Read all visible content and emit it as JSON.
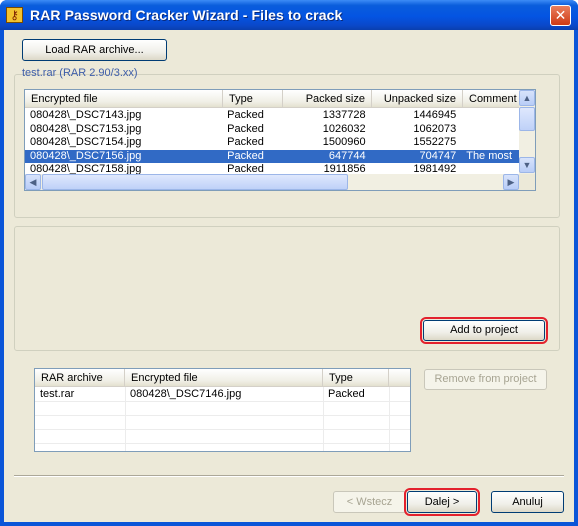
{
  "window": {
    "title": "RAR Password Cracker Wizard - Files to crack",
    "close_glyph": "✕",
    "icon": "app-icon"
  },
  "load_button": "Load RAR archive...",
  "archive_group_label": "test.rar (RAR 2.90/3.xx)",
  "archive_table": {
    "columns": [
      "Encrypted file",
      "Type",
      "Packed size",
      "Unpacked size",
      "Comment"
    ],
    "rows": [
      {
        "file": "080428\\_DSC7143.jpg",
        "type": "Packed",
        "packed": "1337728",
        "unpacked": "1446945",
        "comment": ""
      },
      {
        "file": "080428\\_DSC7153.jpg",
        "type": "Packed",
        "packed": "1026032",
        "unpacked": "1062073",
        "comment": ""
      },
      {
        "file": "080428\\_DSC7154.jpg",
        "type": "Packed",
        "packed": "1500960",
        "unpacked": "1552275",
        "comment": ""
      },
      {
        "file": "080428\\_DSC7156.jpg",
        "type": "Packed",
        "packed": "647744",
        "unpacked": "704747",
        "comment": "The most"
      },
      {
        "file": "080428\\_DSC7158.jpg",
        "type": "Packed",
        "packed": "1911856",
        "unpacked": "1981492",
        "comment": ""
      }
    ],
    "selected_row": 3
  },
  "add_button": "Add to project",
  "project_table": {
    "columns": [
      "RAR archive",
      "Encrypted file",
      "Type"
    ],
    "rows": [
      {
        "archive": "test.rar",
        "file": "080428\\_DSC7146.jpg",
        "type": "Packed"
      }
    ]
  },
  "remove_button": "Remove from project",
  "nav": {
    "back": "< Wstecz",
    "next": "Dalej >",
    "cancel": "Anuluj"
  },
  "colors": {
    "title_bar": "#0454e2",
    "selection": "#316ac5",
    "highlight": "#e3212d",
    "dialog_bg": "#ece9d8"
  }
}
